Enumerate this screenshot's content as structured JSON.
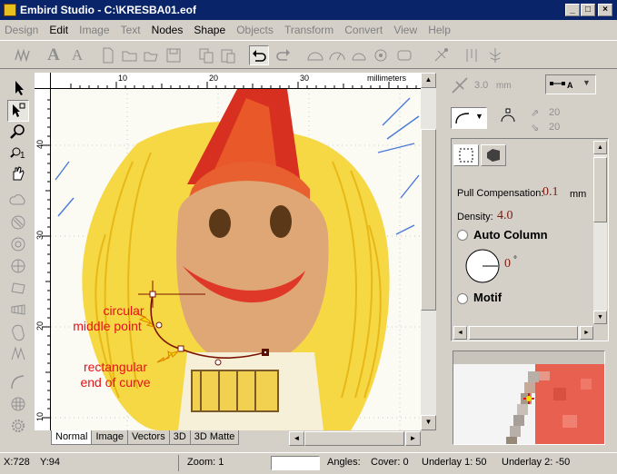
{
  "window": {
    "title": "Embird Studio - C:\\KRESBA01.eof",
    "icon": "embird-app-icon",
    "controls": [
      "_",
      "□",
      "×"
    ]
  },
  "menu": {
    "items": [
      {
        "label": "Design",
        "enabled": false
      },
      {
        "label": "Edit",
        "enabled": true
      },
      {
        "label": "Image",
        "enabled": false
      },
      {
        "label": "Text",
        "enabled": false
      },
      {
        "label": "Nodes",
        "enabled": true
      },
      {
        "label": "Shape",
        "enabled": true
      },
      {
        "label": "Objects",
        "enabled": false
      },
      {
        "label": "Transform",
        "enabled": false
      },
      {
        "label": "Convert",
        "enabled": false
      },
      {
        "label": "View",
        "enabled": false
      },
      {
        "label": "Help",
        "enabled": false
      }
    ]
  },
  "rulers": {
    "unit": "millimeters",
    "horizontal_ticks": [
      "10",
      "20",
      "30"
    ],
    "vertical_ticks": [
      "40",
      "30",
      "20",
      "10"
    ]
  },
  "canvas": {
    "annotations": {
      "circular": "circular",
      "middle_point": "middle point",
      "rectangular": "rectangular",
      "end_of_curve": "end of curve"
    }
  },
  "tabs": [
    "Normal",
    "Image",
    "Vectors",
    "3D",
    "3D Matte"
  ],
  "active_tab": "Normal",
  "right_panel": {
    "distance": "3.0",
    "distance_unit": "mm",
    "spin_a": "20",
    "spin_b": "20",
    "pull_compensation_label": "Pull Compensation:",
    "pull_compensation_value": "0.1",
    "pull_compensation_unit": "mm",
    "density_label": "Density:",
    "density_value": "4.0",
    "auto_column_label": "Auto Column",
    "angle_value": "0",
    "angle_unit": "°",
    "motif_label": "Motif"
  },
  "status": {
    "coord_x": "X:728",
    "coord_y": "Y:94",
    "zoom": "Zoom: 1",
    "angles": "Angles:",
    "cover": "Cover: 0",
    "underlay1": "Underlay 1: 50",
    "underlay2": "Underlay 2: -50"
  },
  "colors": {
    "titlebar": "#0a246a",
    "face": "#d4d0c8",
    "annotation": "#e8101a",
    "value_text": "#7b1a10",
    "curve": "#7a1200"
  }
}
